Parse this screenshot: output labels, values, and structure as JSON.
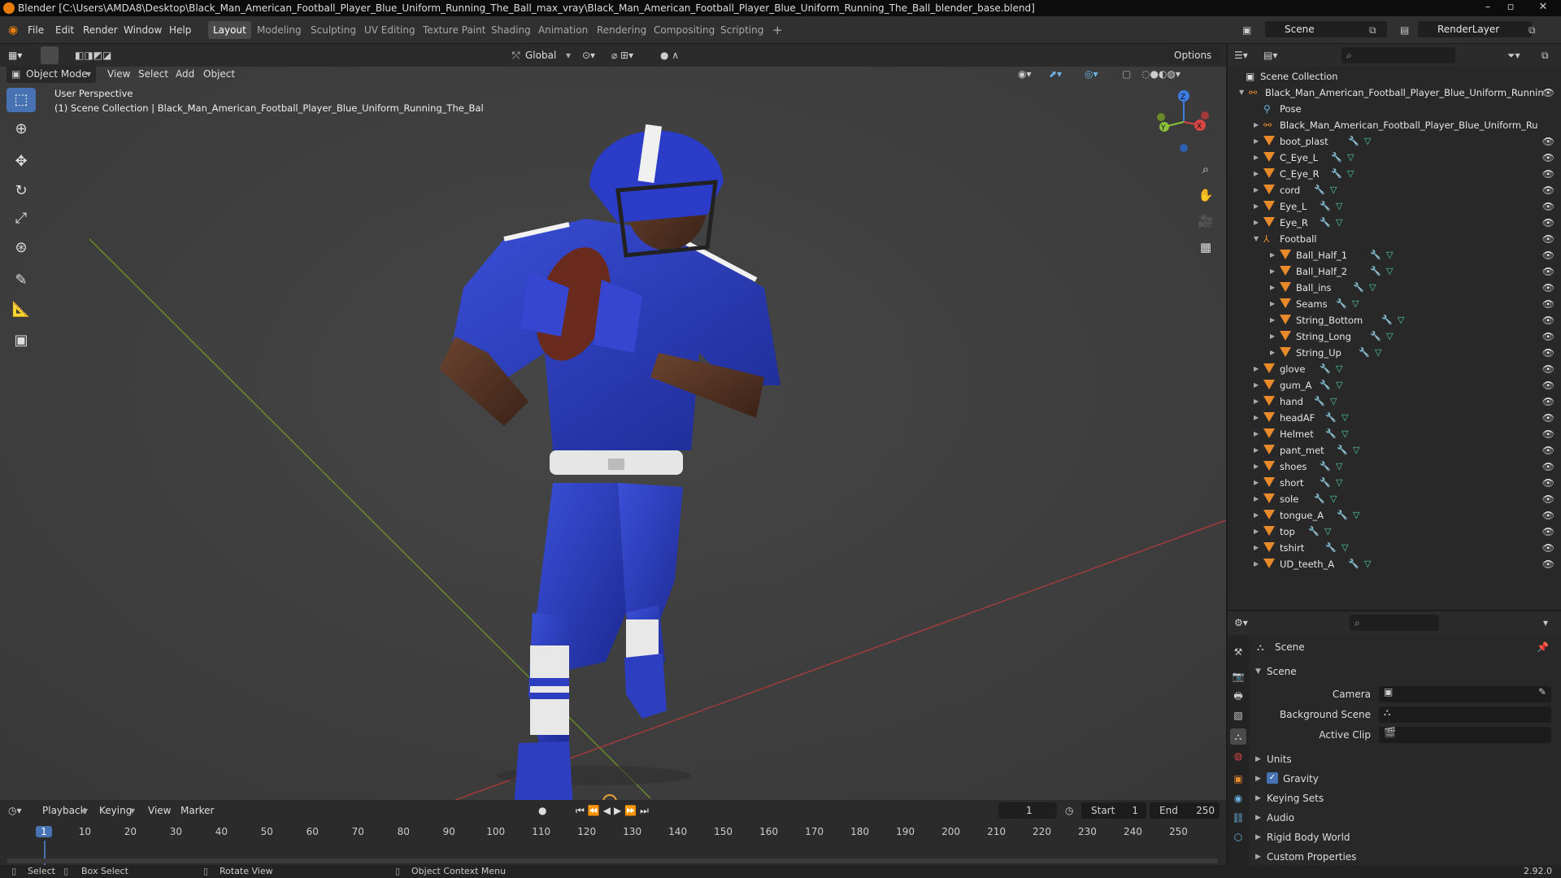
{
  "window": {
    "title": "Blender [C:\\Users\\AMDA8\\Desktop\\Black_Man_American_Football_Player_Blue_Uniform_Running_The_Ball_max_vray\\Black_Man_American_Football_Player_Blue_Uniform_Running_The_Ball_blender_base.blend]"
  },
  "menus": [
    "File",
    "Edit",
    "Render",
    "Window",
    "Help"
  ],
  "workspaces": [
    "Layout",
    "Modeling",
    "Sculpting",
    "UV Editing",
    "Texture Paint",
    "Shading",
    "Animation",
    "Rendering",
    "Compositing",
    "Scripting"
  ],
  "active_workspace": "Layout",
  "scene_field": "Scene",
  "layer_field": "RenderLayer",
  "tool_header": {
    "transform_orientation": "Global",
    "options": "Options"
  },
  "view_header": {
    "mode": "Object Mode",
    "menus": [
      "View",
      "Select",
      "Add",
      "Object"
    ]
  },
  "viewport": {
    "perspective": "User Perspective",
    "collection_info": "(1) Scene Collection | Black_Man_American_Football_Player_Blue_Uniform_Running_The_Bal",
    "gizmo_axes": {
      "z": "Z",
      "y": "Y",
      "x": "X"
    }
  },
  "outliner": {
    "root": "Scene Collection",
    "rows": [
      {
        "name": "Black_Man_American_Football_Player_Blue_Uniform_Runnin",
        "type": "armature-root"
      },
      {
        "name": "Pose",
        "type": "pose"
      },
      {
        "name": "Black_Man_American_Football_Player_Blue_Uniform_Ru",
        "type": "armature"
      },
      {
        "name": "boot_plast",
        "type": "mesh"
      },
      {
        "name": "C_Eye_L",
        "type": "mesh"
      },
      {
        "name": "C_Eye_R",
        "type": "mesh"
      },
      {
        "name": "cord",
        "type": "mesh"
      },
      {
        "name": "Eye_L",
        "type": "mesh"
      },
      {
        "name": "Eye_R",
        "type": "mesh"
      },
      {
        "name": "Football",
        "type": "empty"
      },
      {
        "name": "Ball_Half_1",
        "type": "child"
      },
      {
        "name": "Ball_Half_2",
        "type": "child"
      },
      {
        "name": "Ball_ins",
        "type": "child"
      },
      {
        "name": "Seams",
        "type": "child"
      },
      {
        "name": "String_Bottom",
        "type": "child"
      },
      {
        "name": "String_Long",
        "type": "child"
      },
      {
        "name": "String_Up",
        "type": "child"
      },
      {
        "name": "glove",
        "type": "mesh"
      },
      {
        "name": "gum_A",
        "type": "mesh"
      },
      {
        "name": "hand",
        "type": "mesh"
      },
      {
        "name": "headAF",
        "type": "mesh"
      },
      {
        "name": "Helmet",
        "type": "mesh"
      },
      {
        "name": "pant_met",
        "type": "mesh"
      },
      {
        "name": "shoes",
        "type": "mesh"
      },
      {
        "name": "short",
        "type": "mesh"
      },
      {
        "name": "sole",
        "type": "mesh"
      },
      {
        "name": "tongue_A",
        "type": "mesh"
      },
      {
        "name": "top",
        "type": "mesh"
      },
      {
        "name": "tshirt",
        "type": "mesh"
      },
      {
        "name": "UD_teeth_A",
        "type": "mesh"
      }
    ]
  },
  "properties": {
    "header": "Scene",
    "panel": "Scene",
    "fields": [
      "Camera",
      "Background Scene",
      "Active Clip"
    ],
    "subpanels": [
      "Units",
      "Gravity",
      "Keying Sets",
      "Audio",
      "Rigid Body World",
      "Custom Properties"
    ],
    "gravity_checked": true
  },
  "timeline": {
    "menus": [
      "Playback",
      "Keying",
      "View",
      "Marker"
    ],
    "current_frame": "1",
    "start_label": "Start",
    "start": "1",
    "end_label": "End",
    "end": "250",
    "frame_ticks": [
      "1",
      "10",
      "20",
      "30",
      "40",
      "50",
      "60",
      "70",
      "80",
      "90",
      "100",
      "110",
      "120",
      "130",
      "140",
      "150",
      "160",
      "170",
      "180",
      "190",
      "200",
      "210",
      "220",
      "230",
      "240",
      "250"
    ]
  },
  "status": {
    "select": "Select",
    "box_select": "Box Select",
    "rotate": "Rotate View",
    "context": "Object Context Menu",
    "version": "2.92.0"
  }
}
